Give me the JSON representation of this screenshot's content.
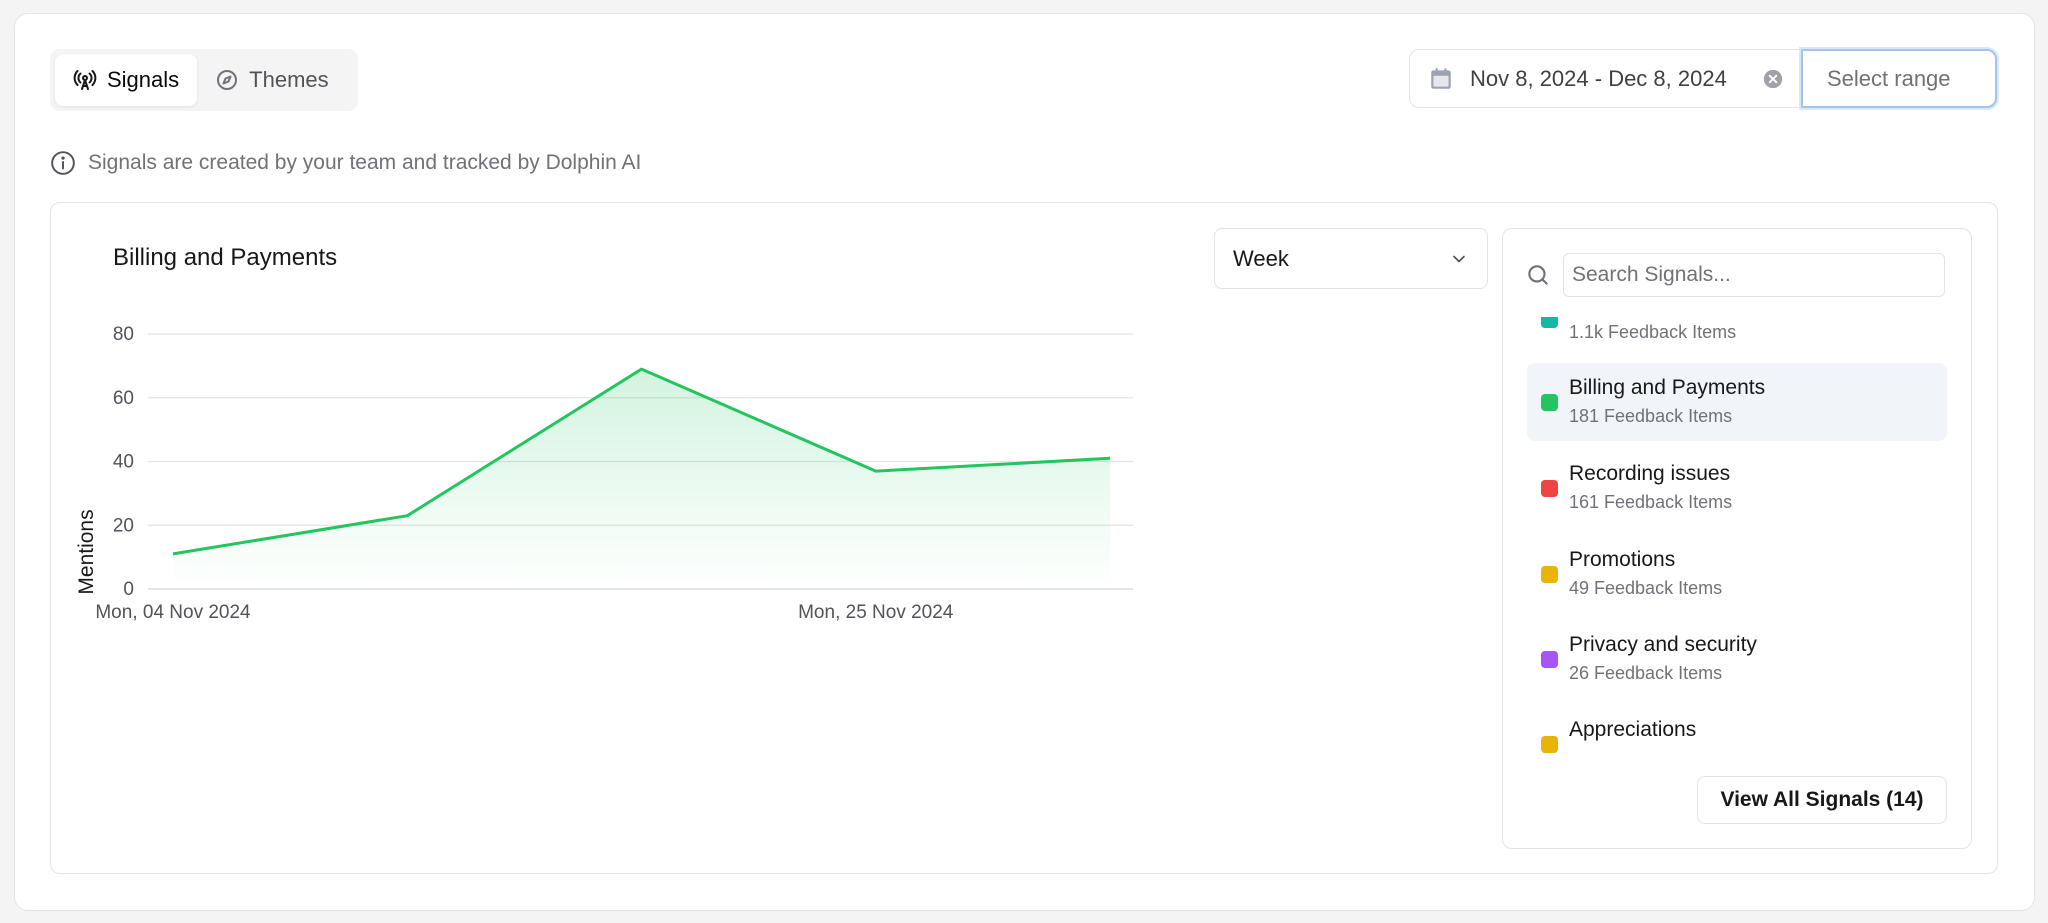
{
  "tabs": [
    {
      "label": "Signals",
      "icon": "broadcast-icon",
      "active": true
    },
    {
      "label": "Themes",
      "icon": "compass-icon",
      "active": false
    }
  ],
  "date_range": {
    "value": "Nov 8, 2024 - Dec 8, 2024",
    "select_placeholder": "Select range"
  },
  "info_text": "Signals are created by your team and tracked by Dolphin AI",
  "chart_title": "Billing and Payments",
  "interval_select": {
    "value": "Week"
  },
  "chart_data": {
    "type": "area",
    "title": "Billing and Payments",
    "ylabel": "Mentions",
    "xlabel": "",
    "ylim": [
      0,
      80
    ],
    "yticks": [
      0,
      20,
      40,
      60,
      80
    ],
    "x_tick_labels": [
      "Mon, 04 Nov 2024",
      "Mon, 25 Nov 2024"
    ],
    "x": [
      "Mon, 04 Nov 2024",
      "Mon, 11 Nov 2024",
      "Mon, 18 Nov 2024",
      "Mon, 25 Nov 2024",
      "Mon, 02 Dec 2024"
    ],
    "series": [
      {
        "values": [
          11,
          23,
          69,
          37,
          41
        ],
        "color": "#22c55e"
      }
    ],
    "grid": true
  },
  "signals_panel": {
    "search_placeholder": "Search Signals...",
    "items": [
      {
        "name": "",
        "count": "1.1k Feedback Items",
        "color": "#14b8a6",
        "selected": false
      },
      {
        "name": "Billing and Payments",
        "count": "181 Feedback Items",
        "color": "#22c55e",
        "selected": true
      },
      {
        "name": "Recording issues",
        "count": "161 Feedback Items",
        "color": "#ef4444",
        "selected": false
      },
      {
        "name": "Promotions",
        "count": "49 Feedback Items",
        "color": "#eab308",
        "selected": false
      },
      {
        "name": "Privacy and security",
        "count": "26 Feedback Items",
        "color": "#a855f7",
        "selected": false
      },
      {
        "name": "Appreciations",
        "count": "",
        "color": "#eab308",
        "selected": false
      }
    ],
    "view_all_label": "View All Signals (14)"
  }
}
